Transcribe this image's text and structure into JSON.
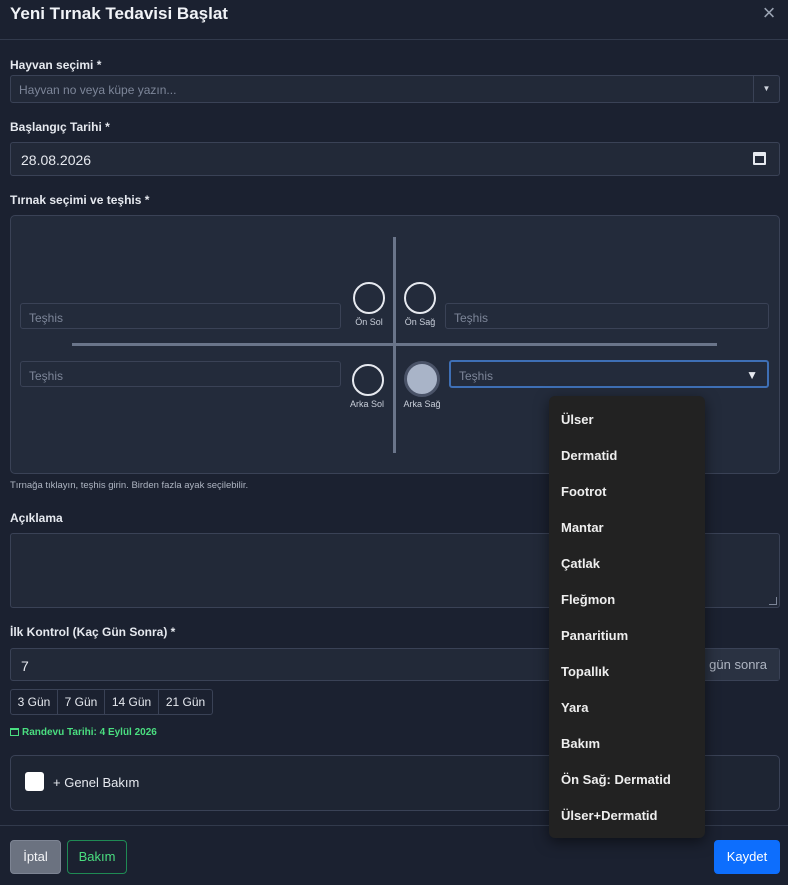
{
  "modal": {
    "title": "Yeni Tırnak Tedavisi Başlat"
  },
  "animal": {
    "label": "Hayvan seçimi *",
    "placeholder": "Hayvan no veya küpe yazın..."
  },
  "start_date": {
    "label": "Başlangıç Tarihi *",
    "value": "28.08.2026"
  },
  "claw_selection": {
    "label": "Tırnak seçimi ve teşhis *",
    "diagnosis_placeholder": "Teşhis",
    "claws": [
      {
        "label": "Ön Sol",
        "selected": false
      },
      {
        "label": "Ön Sağ",
        "selected": false
      },
      {
        "label": "Arka Sol",
        "selected": false
      },
      {
        "label": "Arka Sağ",
        "selected": true
      }
    ],
    "help_text": "Tırnağa tıklayın, teşhis girin. Birden fazla ayak seçilebilir."
  },
  "description": {
    "label": "Açıklama",
    "value": ""
  },
  "first_control": {
    "label": "İlk Kontrol (Kaç Gün Sonra) *",
    "value": "7",
    "suffix": "gün sonra",
    "quick_options": [
      "3 Gün",
      "7 Gün",
      "14 Gün",
      "21 Gün"
    ],
    "appointment_text": "Randevu Tarihi: 4 Eylül 2026"
  },
  "general_care": {
    "label": "+ Genel Bakım",
    "checked": false
  },
  "footer": {
    "cancel": "İptal",
    "care": "Bakım",
    "save": "Kaydet"
  },
  "diagnosis_options": [
    "Ülser",
    "Dermatid",
    "Footrot",
    "Mantar",
    "Çatlak",
    "Fleğmon",
    "Panaritium",
    "Topallık",
    "Yara",
    "Bakım",
    "Ön Sağ: Dermatid",
    "Ülser+Dermatid"
  ],
  "colors": {
    "primary": "#0d6efd",
    "success": "#4ade80",
    "background": "#1b2130"
  }
}
